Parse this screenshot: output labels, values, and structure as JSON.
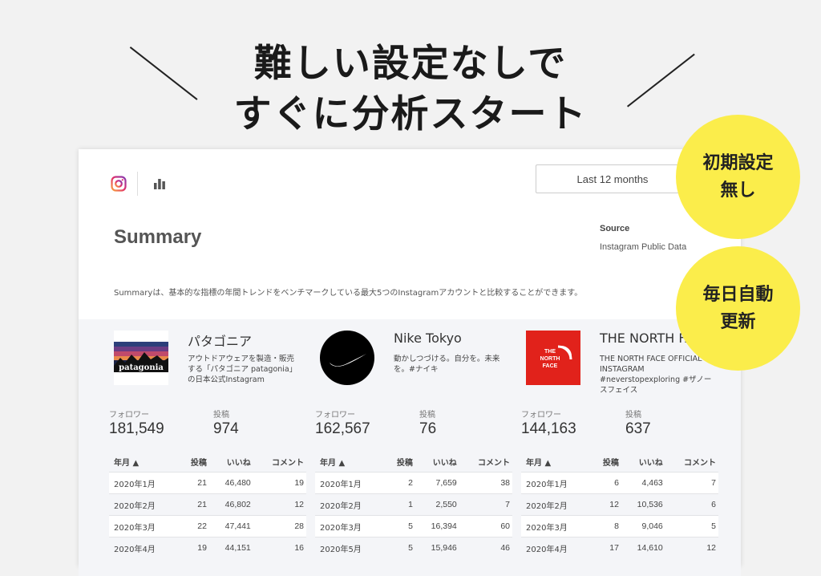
{
  "headline": {
    "line1": "難しい設定なしで",
    "line2": "すぐに分析スタート"
  },
  "badges": [
    {
      "line1": "初期設定",
      "line2": "無し"
    },
    {
      "line1": "毎日自動",
      "line2": "更新"
    }
  ],
  "toolbar": {
    "date_range": "Last 12 months"
  },
  "summary": {
    "title": "Summary",
    "source_label": "Source",
    "source_value": "Instagram Public Data",
    "description": "Summaryは、基本的な指標の年間トレンドをベンチマークしている最大5つのInstagramアカウントと比較することができます。"
  },
  "colors": {
    "badge": "#fbed4b",
    "panel": "#f4f5f8"
  },
  "accounts": [
    {
      "name": "パタゴニア",
      "logo": "patagonia-logo",
      "logo_text": "patagonia",
      "bio": "アウトドアウェアを製造・販売する「パタゴニア patagonia」の日本公式Instagram",
      "followers_label": "フォロワー",
      "followers": "181,549",
      "posts_label": "投稿",
      "posts": "974",
      "columns": [
        "年月 ▲",
        "投稿",
        "いいね",
        "コメント"
      ],
      "rows": [
        [
          "2020年1月",
          "21",
          "46,480",
          "19"
        ],
        [
          "2020年2月",
          "21",
          "46,802",
          "12"
        ],
        [
          "2020年3月",
          "22",
          "47,441",
          "28"
        ],
        [
          "2020年4月",
          "19",
          "44,151",
          "16"
        ]
      ]
    },
    {
      "name": "Nike Tokyo",
      "logo": "nike-logo",
      "logo_text": "",
      "bio": "動かしつづける。自分を。未来を。#ナイキ",
      "followers_label": "フォロワー",
      "followers": "162,567",
      "posts_label": "投稿",
      "posts": "76",
      "columns": [
        "年月 ▲",
        "投稿",
        "いいね",
        "コメント"
      ],
      "rows": [
        [
          "2020年1月",
          "2",
          "7,659",
          "38"
        ],
        [
          "2020年2月",
          "1",
          "2,550",
          "7"
        ],
        [
          "2020年3月",
          "5",
          "16,394",
          "60"
        ],
        [
          "2020年5月",
          "5",
          "15,946",
          "46"
        ]
      ]
    },
    {
      "name": "THE NORTH FACE",
      "logo": "the-north-face-logo",
      "logo_text": "THE NORTH FACE",
      "bio": "THE NORTH FACE OFFICIAL INSTAGRAM #neverstopexploring #ザノースフェイス",
      "followers_label": "フォロワー",
      "followers": "144,163",
      "posts_label": "投稿",
      "posts": "637",
      "columns": [
        "年月 ▲",
        "投稿",
        "いいね",
        "コメント"
      ],
      "rows": [
        [
          "2020年1月",
          "6",
          "4,463",
          "7"
        ],
        [
          "2020年2月",
          "12",
          "10,536",
          "6"
        ],
        [
          "2020年3月",
          "8",
          "9,046",
          "5"
        ],
        [
          "2020年4月",
          "17",
          "14,610",
          "12"
        ]
      ]
    }
  ]
}
